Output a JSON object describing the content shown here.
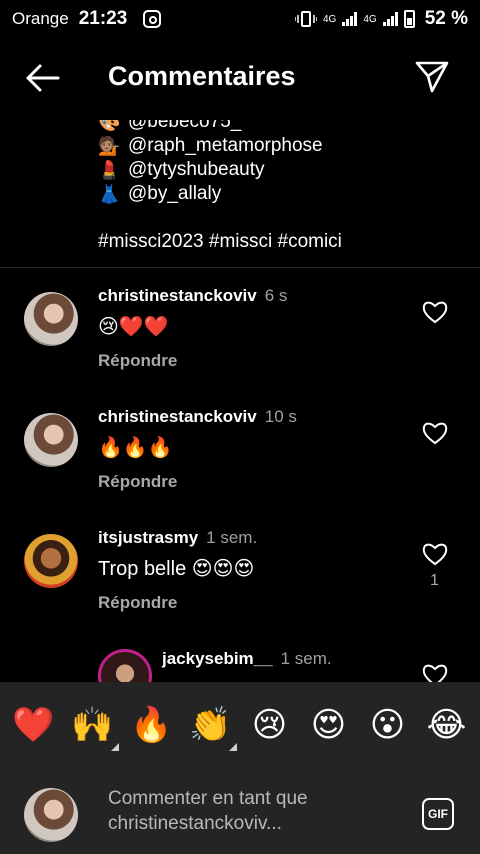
{
  "status_bar": {
    "carrier": "Orange",
    "time": "21:23",
    "network_1": "4G",
    "network_2": "4G",
    "battery": "52 %"
  },
  "header": {
    "title": "Commentaires"
  },
  "caption": {
    "mentions": [
      {
        "emoji": "🎨",
        "text": "@bebeco75_"
      },
      {
        "emoji": "💁🏽",
        "text": "@raph_metamorphose"
      },
      {
        "emoji": "💄",
        "text": "@tytyshubeauty"
      },
      {
        "emoji": "👗",
        "text": "@by_allaly"
      }
    ],
    "hashtags": "#missci2023 #missci #comici"
  },
  "comments": [
    {
      "user": "christinestanckoviv",
      "time": "6 s",
      "text": "😢❤️❤️",
      "reply": "Répondre",
      "likes": ""
    },
    {
      "user": "christinestanckoviv",
      "time": "10 s",
      "text": "🔥🔥🔥",
      "reply": "Répondre",
      "likes": ""
    },
    {
      "user": "itsjustrasmy",
      "time": "1 sem.",
      "text": "Trop belle 😍😍😍",
      "reply": "Répondre",
      "likes": "1"
    },
    {
      "user": "jackysebim__",
      "time": "1 sem.",
      "text": "",
      "reply": "",
      "likes": ""
    }
  ],
  "reactions": [
    "❤️",
    "🙌",
    "🔥",
    "👏",
    "😢",
    "😍",
    "😮",
    "😂"
  ],
  "compose": {
    "placeholder": "Commenter en tant que christinestanckoviv...",
    "gif_label": "GIF"
  }
}
